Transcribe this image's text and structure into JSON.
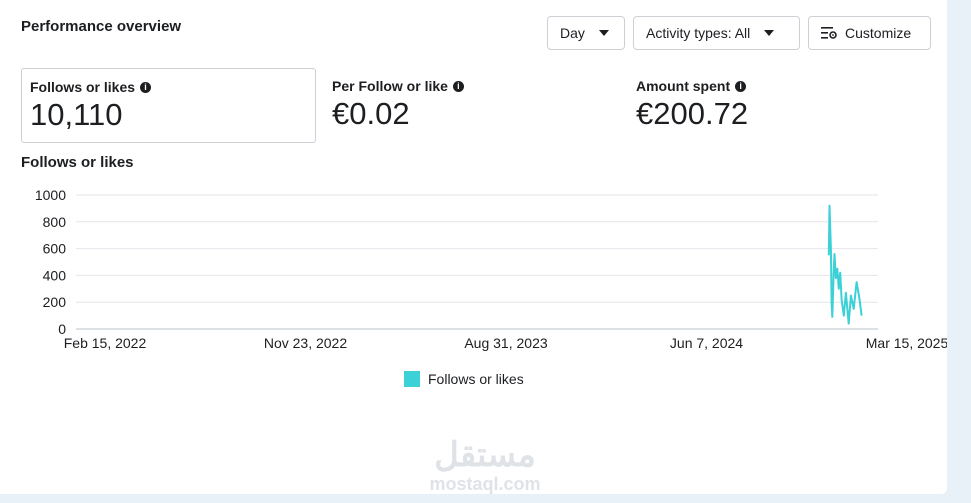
{
  "header": {
    "title": "Performance overview"
  },
  "controls": {
    "day_label": "Day",
    "activity_label": "Activity types: All",
    "customize_label": "Customize"
  },
  "metrics": [
    {
      "label": "Follows or likes",
      "value": "10,110"
    },
    {
      "label": "Per Follow or like",
      "value": "€0.02"
    },
    {
      "label": "Amount spent",
      "value": "€200.72"
    }
  ],
  "chart_title": "Follows or likes",
  "icons": {
    "info": "info-icon",
    "caret": "caret-down-icon",
    "customize": "settings-list-icon"
  },
  "colors": {
    "series": "#3bd1d6",
    "grid": "#e4e6eb"
  },
  "chart_data": {
    "type": "line",
    "title": "Follows or likes",
    "ylim": [
      0,
      1000
    ],
    "yticks": [
      0,
      200,
      400,
      600,
      800,
      1000
    ],
    "xticks": [
      "Feb 15, 2022",
      "Nov 23, 2022",
      "Aug 31, 2023",
      "Jun 7, 2024",
      "Mar 15, 2025"
    ],
    "x_range": [
      "2022-02-15",
      "2025-03-15"
    ],
    "grid": true,
    "legend": "bottom-center",
    "series": [
      {
        "name": "Follows or likes",
        "points": [
          [
            "2025-01-05",
            550
          ],
          [
            "2025-01-06",
            920
          ],
          [
            "2025-01-08",
            600
          ],
          [
            "2025-01-09",
            200
          ],
          [
            "2025-01-10",
            90
          ],
          [
            "2025-01-12",
            450
          ],
          [
            "2025-01-13",
            560
          ],
          [
            "2025-01-15",
            380
          ],
          [
            "2025-01-17",
            450
          ],
          [
            "2025-01-19",
            300
          ],
          [
            "2025-01-21",
            420
          ],
          [
            "2025-01-23",
            220
          ],
          [
            "2025-01-26",
            100
          ],
          [
            "2025-01-29",
            270
          ],
          [
            "2025-02-02",
            40
          ],
          [
            "2025-02-05",
            250
          ],
          [
            "2025-02-09",
            150
          ],
          [
            "2025-02-13",
            350
          ],
          [
            "2025-02-17",
            230
          ],
          [
            "2025-02-20",
            100
          ]
        ]
      }
    ]
  },
  "legend_label": "Follows or likes",
  "watermark": {
    "arabic": "مستقل",
    "latin": "mostaql.com"
  }
}
